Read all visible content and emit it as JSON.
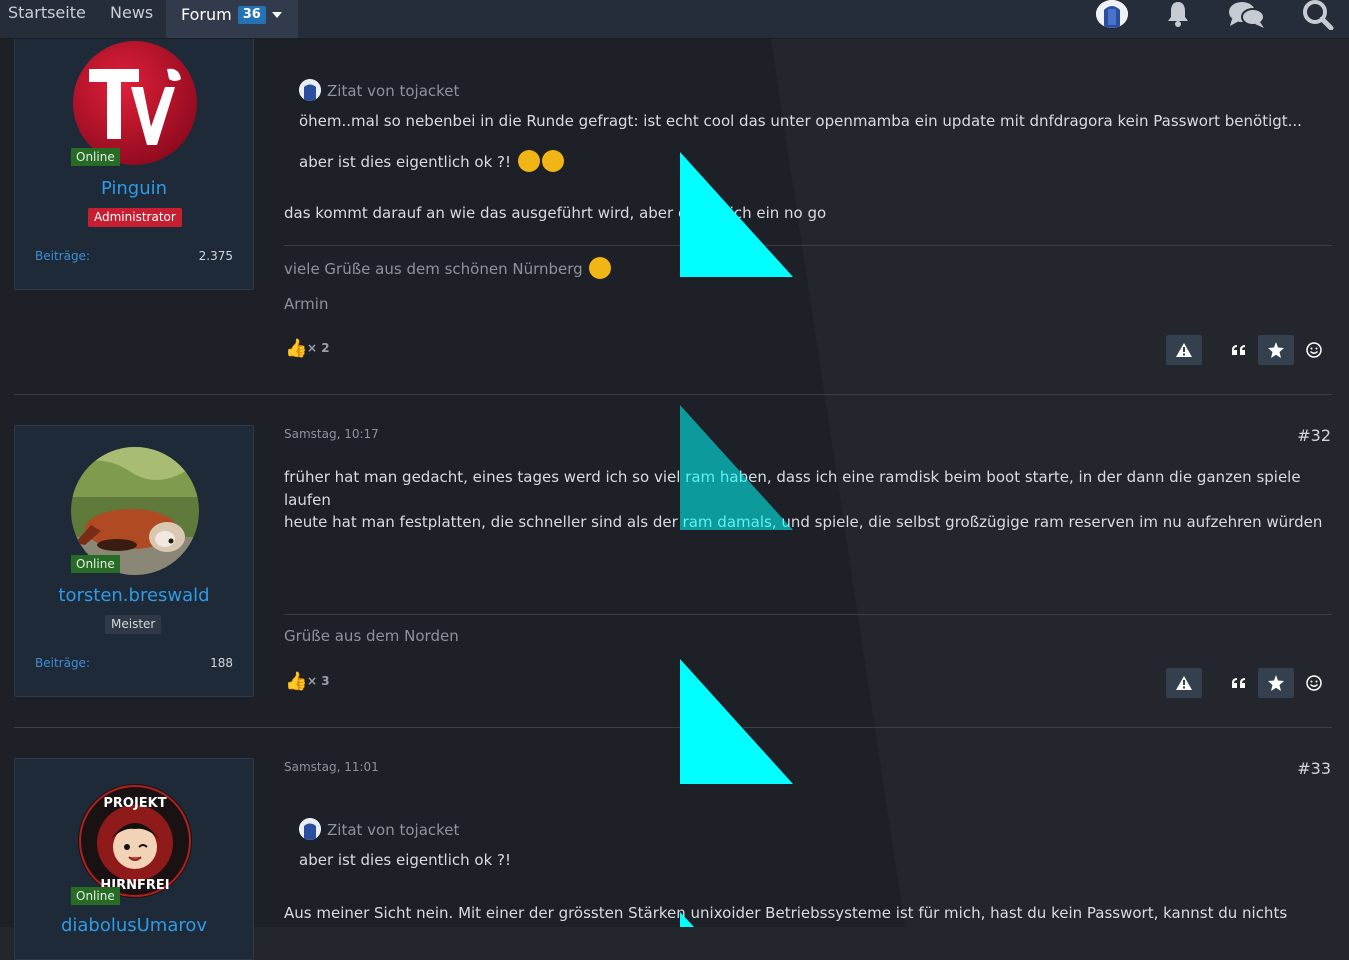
{
  "nav": {
    "items": [
      "Startseite",
      "News"
    ],
    "forum_label": "Forum",
    "forum_count": "36"
  },
  "posts": [
    {
      "user": {
        "name": "Pinguin",
        "status": "Online",
        "rank": "Administrator",
        "stat_label": "Beiträge:",
        "stat_value": "2.375"
      },
      "quote": {
        "author": "Zitat von tojacket",
        "line1": "öhem..mal so nebenbei in die Runde gefragt: ist echt cool das unter openmamba ein update mit dnfdragora kein Passwort benötigt...",
        "line2": "aber ist dies eigentlich ok ?!"
      },
      "body": "das kommt darauf an wie das ausgeführt wird, aber eigentlich ein no go",
      "signature1": "viele Grüße aus dem schönen Nürnberg",
      "signature2": "Armin",
      "reactions": "× 2"
    },
    {
      "date": "Samstag, 10:17",
      "number": "#32",
      "user": {
        "name": "torsten.breswald",
        "status": "Online",
        "rank": "Meister",
        "stat_label": "Beiträge:",
        "stat_value": "188"
      },
      "body1": "früher hat man gedacht, eines tages werd ich so viel ram haben, dass ich eine ramdisk beim boot starte, in der dann die ganzen spiele",
      "body2": "laufen",
      "body3": "heute hat man festplatten, die schneller sind als der ram damals, und spiele, die selbst großzügige ram reserven im nu aufzehren würden",
      "signature1": "Grüße aus dem Norden",
      "reactions": "× 3"
    },
    {
      "date": "Samstag, 11:01",
      "number": "#33",
      "user": {
        "name": "diabolusUmarov",
        "status": "Online"
      },
      "avatar_text": "PROJEKT HIRNFREI",
      "quote": {
        "author": "Zitat von tojacket",
        "line1": "aber ist dies eigentlich ok ?!"
      },
      "body": "Aus meiner Sicht nein. Mit einer der grössten Stärken unixoider Betriebssysteme ist für mich, hast du kein Passwort, kannst du nichts"
    }
  ],
  "colors": {
    "accent": "#2e9be6",
    "online": "#276b26",
    "admin": "#c81e32",
    "overlay": "#00ffff"
  }
}
